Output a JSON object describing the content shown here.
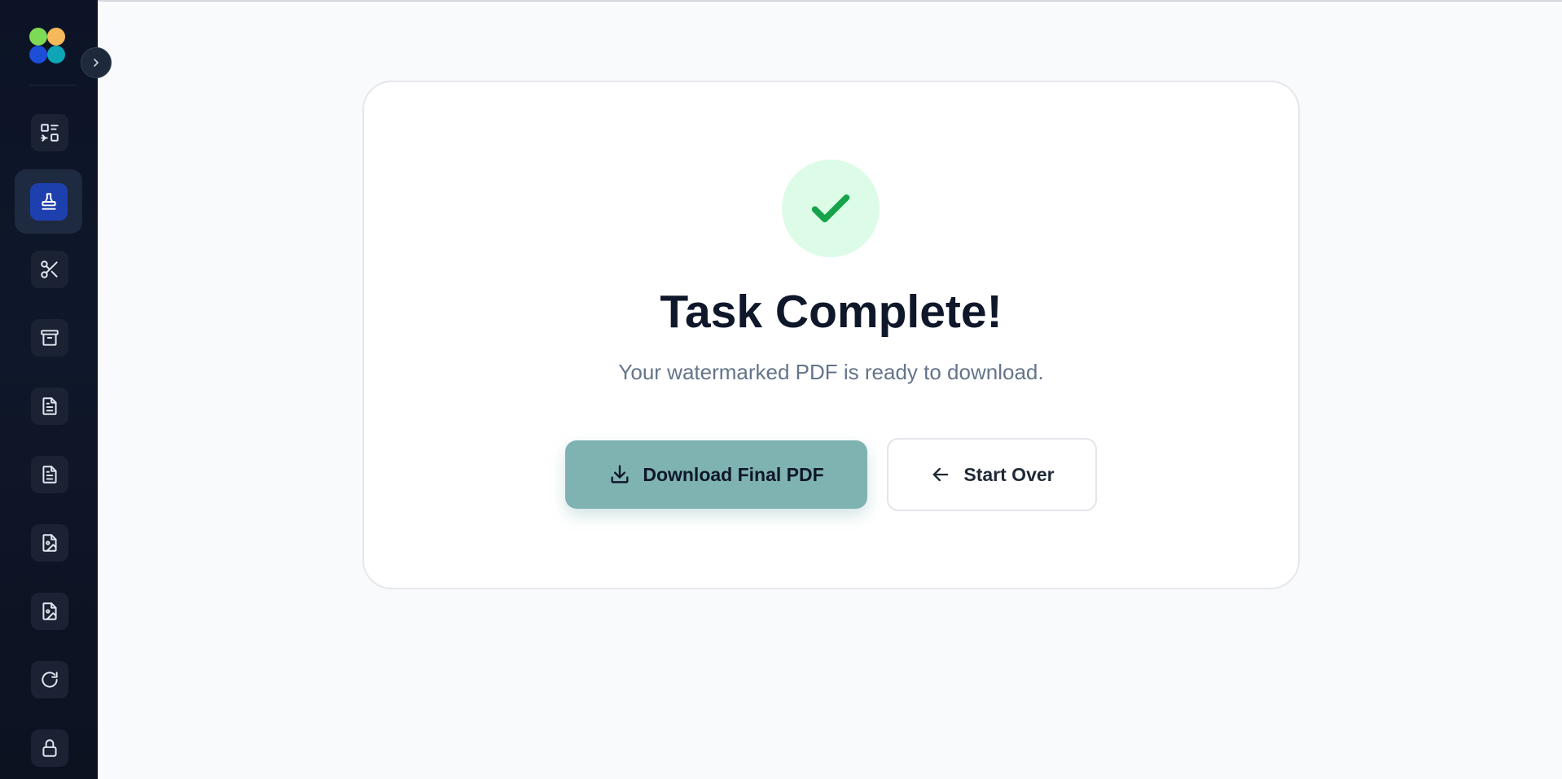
{
  "sidebar": {
    "logo_colors": [
      "#7ed957",
      "#f6b95a",
      "#1d4ed8",
      "#0ea5b7"
    ],
    "collapse_icon": "chevron-right-icon",
    "items": [
      {
        "icon": "convert-icon",
        "active": false
      },
      {
        "icon": "stamp-icon",
        "active": true
      },
      {
        "icon": "scissors-icon",
        "active": false
      },
      {
        "icon": "archive-icon",
        "active": false
      },
      {
        "icon": "document-icon",
        "active": false
      },
      {
        "icon": "document-icon",
        "active": false
      },
      {
        "icon": "image-file-icon",
        "active": false
      },
      {
        "icon": "image-file-icon",
        "active": false
      },
      {
        "icon": "refresh-icon",
        "active": false
      },
      {
        "icon": "lock-icon",
        "active": false
      }
    ]
  },
  "main": {
    "status_icon": "check-icon",
    "title": "Task Complete!",
    "subtitle": "Your watermarked PDF is ready to download.",
    "download_button": {
      "label": "Download Final PDF",
      "icon": "download-icon"
    },
    "start_over_button": {
      "label": "Start Over",
      "icon": "arrow-left-icon"
    }
  },
  "colors": {
    "sidebar_bg": "#0f172a",
    "active_item": "#1e40af",
    "success_bg": "#dcfce7",
    "success_check": "#16a34a",
    "download_button_bg": "#7fb3b1"
  }
}
